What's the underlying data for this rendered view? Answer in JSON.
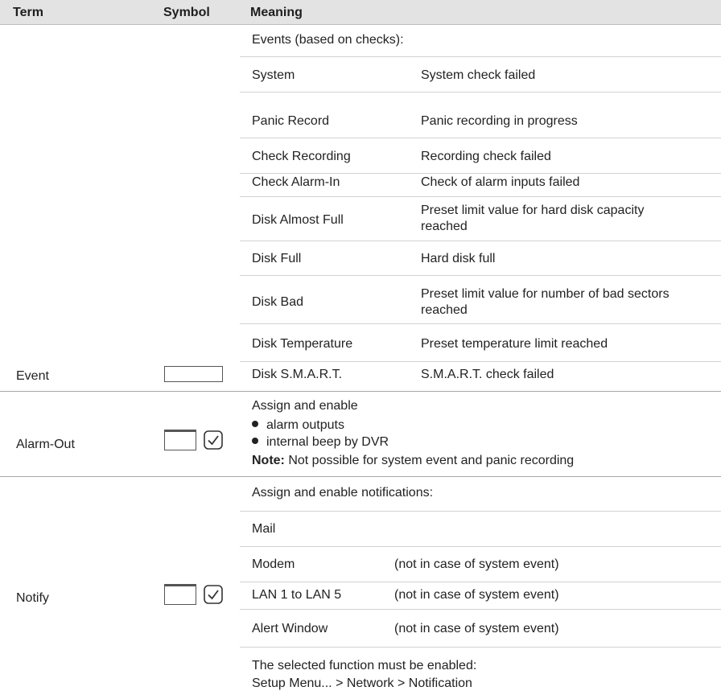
{
  "header": {
    "term": "Term",
    "symbol": "Symbol",
    "meaning": "Meaning"
  },
  "event": {
    "term": "Event",
    "intro": "Events (based on checks):",
    "rows": [
      {
        "name": "System",
        "desc": "System check failed"
      },
      {
        "name": "Panic Record",
        "desc": "Panic recording in progress"
      },
      {
        "name": "Check Recording",
        "desc": "Recording check failed"
      },
      {
        "name": "Check Alarm-In",
        "desc": "Check of alarm inputs failed"
      },
      {
        "name": "Disk Almost Full",
        "desc": "Preset limit value for hard disk capacity reached"
      },
      {
        "name": "Disk Full",
        "desc": "Hard disk full"
      },
      {
        "name": "Disk Bad",
        "desc": "Preset limit value for number of bad sectors reached"
      },
      {
        "name": "Disk Temperature",
        "desc": "Preset temperature limit reached"
      },
      {
        "name": "Disk  S.M.A.R.T.",
        "desc": "S.M.A.R.T. check failed"
      }
    ]
  },
  "alarm_out": {
    "term": "Alarm-Out",
    "intro": "Assign and enable",
    "bullets": [
      "alarm outputs",
      "internal beep by DVR"
    ],
    "note_label": "Note:",
    "note_text": " Not possible for system event and panic recording"
  },
  "notify": {
    "term": "Notify",
    "intro": "Assign and enable notifications:",
    "rows": [
      {
        "name": "Mail",
        "desc": ""
      },
      {
        "name": "Modem",
        "desc": "(not in case of system event)"
      },
      {
        "name": "LAN 1 to LAN 5",
        "desc": "(not in case of system event)"
      },
      {
        "name": "Alert Window",
        "desc": "(not in case of system event)"
      }
    ],
    "footer_line1": "The selected function must be enabled:",
    "footer_line2": "Setup Menu... > Network > Notification"
  }
}
